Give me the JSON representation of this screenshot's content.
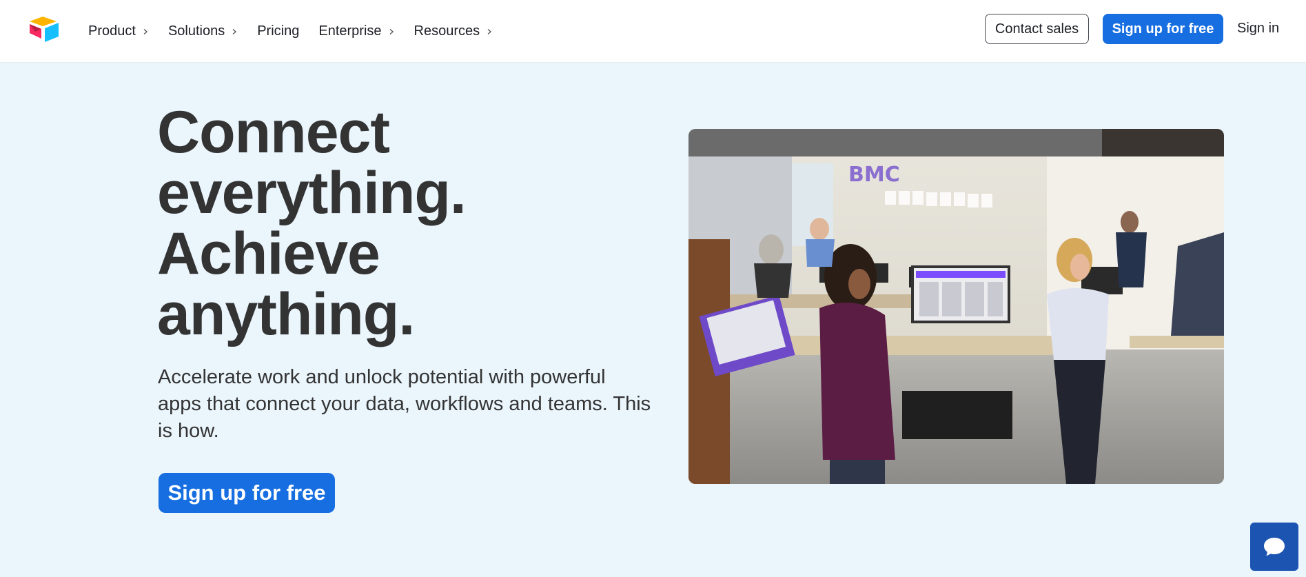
{
  "nav": {
    "items": [
      {
        "label": "Product",
        "has_submenu": true
      },
      {
        "label": "Solutions",
        "has_submenu": true
      },
      {
        "label": "Pricing",
        "has_submenu": false
      },
      {
        "label": "Enterprise",
        "has_submenu": true
      },
      {
        "label": "Resources",
        "has_submenu": true
      }
    ],
    "contact_sales": "Contact sales",
    "signup": "Sign up for free",
    "signin": "Sign in"
  },
  "hero": {
    "title_lines": [
      "Connect",
      "everything.",
      "Achieve",
      "anything."
    ],
    "subtitle": "Accelerate work and unlock potential with powerful apps that connect your data, workflows and teams. This is how.",
    "cta": "Sign up for free",
    "photo_wall_text": "BMC"
  },
  "icons": {
    "logo": "airtable-logo-icon",
    "chevron": "chevron-right-icon",
    "chat": "chat-bubble-icon"
  },
  "colors": {
    "primary": "#166ee1",
    "hero_bg": "#eaf5fc",
    "heading": "#333333",
    "chat_bg": "#1c54b2"
  }
}
